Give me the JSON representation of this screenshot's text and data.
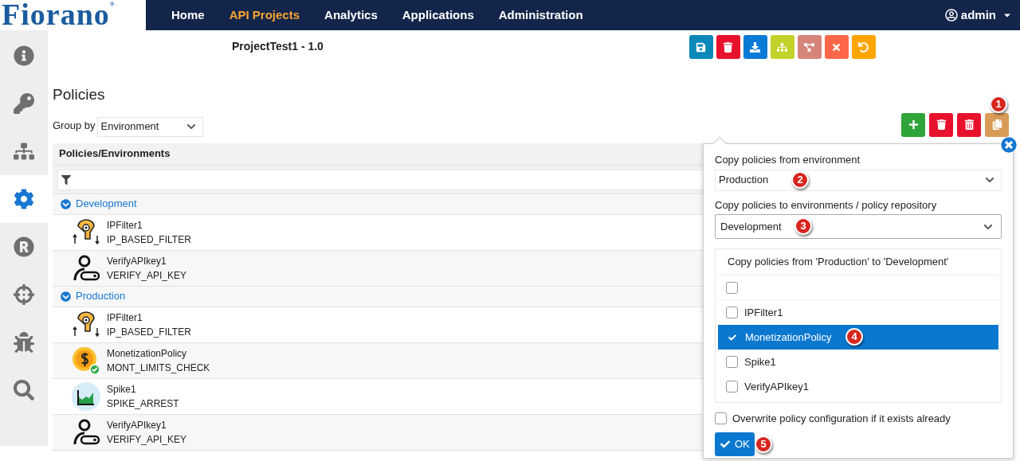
{
  "header": {
    "logo": "Fiorano",
    "logo_mark": "®",
    "nav": [
      {
        "label": "Home",
        "selected": false
      },
      {
        "label": "API Projects",
        "selected": true
      },
      {
        "label": "Analytics",
        "selected": false
      },
      {
        "label": "Applications",
        "selected": false
      },
      {
        "label": "Administration",
        "selected": false
      }
    ],
    "user": "admin"
  },
  "sidebar": {
    "items": [
      {
        "kind": "info",
        "selected": false
      },
      {
        "kind": "key",
        "selected": false
      },
      {
        "kind": "flow",
        "selected": false
      },
      {
        "kind": "settings",
        "selected": true
      },
      {
        "kind": "registered",
        "selected": false
      },
      {
        "kind": "target",
        "selected": false
      },
      {
        "kind": "bug",
        "selected": false
      },
      {
        "kind": "search",
        "selected": false
      }
    ]
  },
  "project_title": "ProjectTest1 - 1.0",
  "toolbar": [
    {
      "kind": "save",
      "color": "#0a88b8"
    },
    {
      "kind": "delete",
      "color": "#e8112d"
    },
    {
      "kind": "download",
      "color": "#0b7ad6"
    },
    {
      "kind": "hierarchy",
      "color": "#c3d22a"
    },
    {
      "kind": "diagram",
      "color": "#d5857a"
    },
    {
      "kind": "close",
      "color": "#fe6849"
    },
    {
      "kind": "undo",
      "color": "#fea500"
    }
  ],
  "section_title": "Policies",
  "group_by": {
    "label": "Group by",
    "value": "Environment"
  },
  "policy_actions": [
    {
      "kind": "add",
      "color": "#2fa43a"
    },
    {
      "kind": "delete",
      "color": "#e8112d"
    },
    {
      "kind": "delete-all",
      "color": "#e8112d"
    },
    {
      "kind": "copy",
      "color": "#d99c56",
      "callout": "1"
    }
  ],
  "table": {
    "column": "Policies/Environments",
    "groups": [
      {
        "name": "Development",
        "expanded": true,
        "children": [
          {
            "kind": "ipfilter",
            "name": "IPFilter1",
            "type": "IP_BASED_FILTER"
          },
          {
            "kind": "apikey",
            "name": "VerifyAPIkey1",
            "type": "VERIFY_API_KEY"
          }
        ]
      },
      {
        "name": "Production",
        "expanded": true,
        "children": [
          {
            "kind": "ipfilter",
            "name": "IPFilter1",
            "type": "IP_BASED_FILTER"
          },
          {
            "kind": "monetization",
            "name": "MonetizationPolicy",
            "type": "MONT_LIMITS_CHECK"
          },
          {
            "kind": "spike",
            "name": "Spike1",
            "type": "SPIKE_ARREST"
          },
          {
            "kind": "apikey",
            "name": "VerifyAPIkey1",
            "type": "VERIFY_API_KEY"
          }
        ]
      }
    ]
  },
  "copy_dialog": {
    "from_label": "Copy policies from environment",
    "from_value": "Production",
    "from_callout": "2",
    "to_label": "Copy policies to environments / policy repository",
    "to_value": "Development",
    "to_callout": "3",
    "list_title": "Copy policies from 'Production' to 'Development'",
    "items": [
      {
        "checked": false,
        "selected": false
      },
      {
        "label": "IPFilter1",
        "checked": false,
        "selected": false
      },
      {
        "label": "MonetizationPolicy",
        "checked": true,
        "selected": true,
        "callout": "4"
      },
      {
        "label": "Spike1",
        "checked": false,
        "selected": false
      },
      {
        "label": "VerifyAPIkey1",
        "checked": false,
        "selected": false
      }
    ],
    "overwrite": {
      "label": "Overwrite policy configuration if it exists already",
      "checked": false
    },
    "ok": {
      "label": "OK",
      "callout": "5"
    }
  }
}
